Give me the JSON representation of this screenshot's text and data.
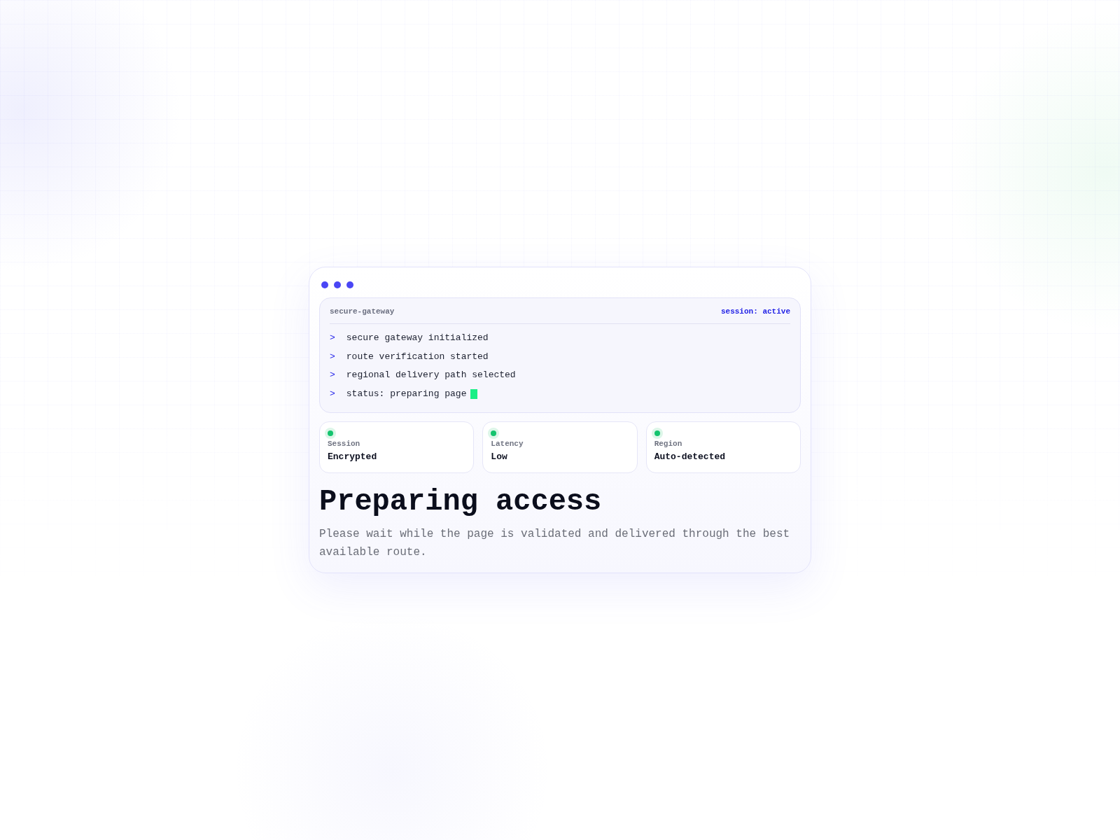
{
  "terminal": {
    "title": "secure-gateway",
    "session_status": "session: active",
    "lines": [
      {
        "prompt": ">",
        "text": "secure gateway initialized",
        "cursor": false
      },
      {
        "prompt": ">",
        "text": "route verification started",
        "cursor": false
      },
      {
        "prompt": ">",
        "text": "regional delivery path selected",
        "cursor": false
      },
      {
        "prompt": ">",
        "text": "status: preparing page",
        "cursor": true
      }
    ]
  },
  "status_cards": [
    {
      "label": "Session",
      "value": "Encrypted"
    },
    {
      "label": "Latency",
      "value": "Low"
    },
    {
      "label": "Region",
      "value": "Auto-detected"
    }
  ],
  "heading": "Preparing access",
  "description": "Please wait while the page is validated and delivered through the best available route."
}
